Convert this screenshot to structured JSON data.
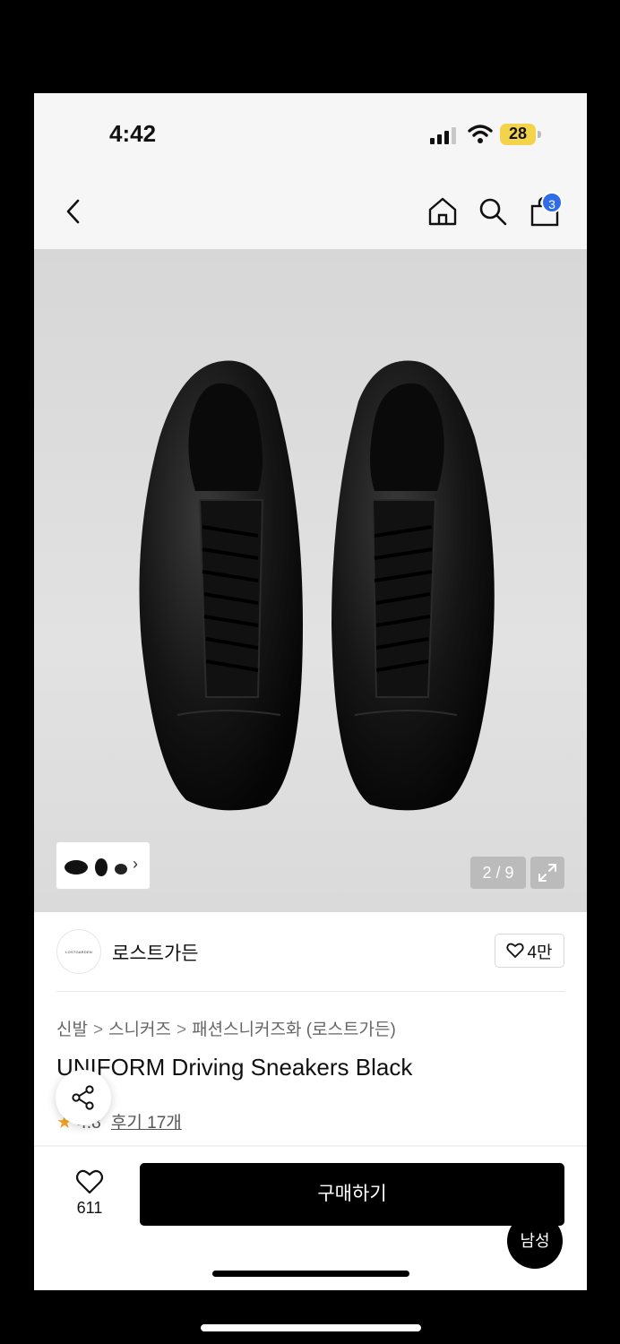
{
  "status_bar": {
    "time": "4:42",
    "battery": "28"
  },
  "nav": {
    "cart_count": "3"
  },
  "gallery": {
    "counter": "2 / 9"
  },
  "brand": {
    "name": "로스트가든",
    "logo_text": "LOSTGARDEN",
    "favorites": "4만"
  },
  "product": {
    "breadcrumbs": [
      "신발",
      "스니커즈",
      "패션스니커즈화 (로스트가든)"
    ],
    "title": "UNIFORM Driving Sneakers Black",
    "rating": "4.8",
    "reviews": "후기 17개"
  },
  "bottom_bar": {
    "likes": "611",
    "buy_label": "구매하기",
    "gender_label": "남성"
  },
  "colors": {
    "accent_badge": "#2f6de6",
    "buy_button": "#000000",
    "star": "#f5a623"
  }
}
